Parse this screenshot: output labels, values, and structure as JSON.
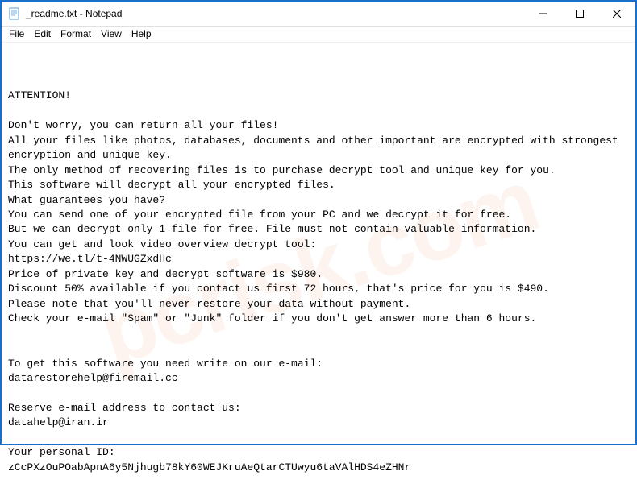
{
  "window": {
    "title": "_readme.txt - Notepad"
  },
  "menu": {
    "file": "File",
    "edit": "Edit",
    "format": "Format",
    "view": "View",
    "help": "Help"
  },
  "document": {
    "body": "ATTENTION!\n\nDon't worry, you can return all your files!\nAll your files like photos, databases, documents and other important are encrypted with strongest encryption and unique key.\nThe only method of recovering files is to purchase decrypt tool and unique key for you.\nThis software will decrypt all your encrypted files.\nWhat guarantees you have?\nYou can send one of your encrypted file from your PC and we decrypt it for free.\nBut we can decrypt only 1 file for free. File must not contain valuable information.\nYou can get and look video overview decrypt tool:\nhttps://we.tl/t-4NWUGZxdHc\nPrice of private key and decrypt software is $980.\nDiscount 50% available if you contact us first 72 hours, that's price for you is $490.\nPlease note that you'll never restore your data without payment.\nCheck your e-mail \"Spam\" or \"Junk\" folder if you don't get answer more than 6 hours.\n\n\nTo get this software you need write on our e-mail:\ndatarestorehelp@firemail.cc\n\nReserve e-mail address to contact us:\ndatahelp@iran.ir\n\nYour personal ID:\nzCcPXzOuPOabApnA6y5Njhugb78kY60WEJKruAeQtarCTUwyu6taVAlHDS4eZHNr"
  },
  "watermark": {
    "text": "pcrisk.com"
  }
}
